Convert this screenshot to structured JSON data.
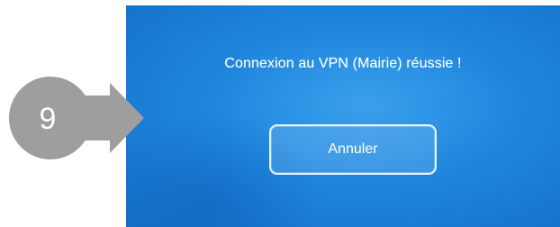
{
  "dialog": {
    "message": "Connexion au VPN (Mairie) réussie !",
    "cancel_label": "Annuler"
  },
  "annotation": {
    "step_number": "9",
    "color": "#9e9e9e"
  },
  "screen": {
    "background_color": "#1f86de"
  }
}
